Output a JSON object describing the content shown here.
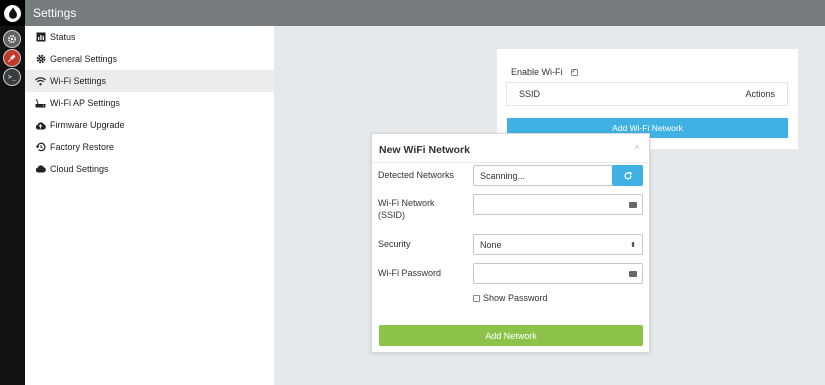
{
  "header": {
    "title": "Settings"
  },
  "rail": {
    "term_glyph": ">_"
  },
  "sidebar": {
    "items": [
      {
        "label": "Status",
        "icon": "bar-chart-icon"
      },
      {
        "label": "General Settings",
        "icon": "gear-icon"
      },
      {
        "label": "Wi-Fi Settings",
        "icon": "wifi-icon",
        "active": true
      },
      {
        "label": "Wi-Fi AP Settings",
        "icon": "router-icon"
      },
      {
        "label": "Firmware Upgrade",
        "icon": "cloud-upload-icon"
      },
      {
        "label": "Factory Restore",
        "icon": "history-icon"
      },
      {
        "label": "Cloud Settings",
        "icon": "cloud-icon"
      }
    ]
  },
  "wifi_card": {
    "enable_label": "Enable Wi-Fi",
    "enable_checked": true,
    "table_headers": {
      "ssid": "SSID",
      "actions": "Actions"
    },
    "add_button": "Add Wi-Fi Network"
  },
  "modal": {
    "title": "New WiFi Network",
    "close_glyph": "×",
    "detected_label": "Detected Networks",
    "detected_value": "Scanning...",
    "ssid_label": "Wi-Fi Network (SSID)",
    "ssid_value": "",
    "security_label": "Security",
    "security_value": "None",
    "password_label": "Wi-Fi Password",
    "password_value": "",
    "show_password_label": "Show Password",
    "add_button": "Add Network"
  },
  "colors": {
    "accent_blue": "#3fb1e3",
    "accent_green": "#8bc34a",
    "header_gray": "#757b7e",
    "rail_red": "#c0392b"
  }
}
